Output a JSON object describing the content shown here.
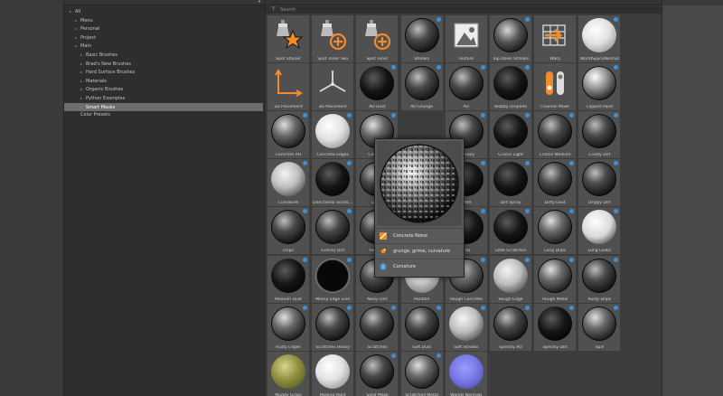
{
  "tree": {
    "items": [
      {
        "label": "All",
        "indent": 0,
        "expandable": true,
        "selected": false
      },
      {
        "label": "Menu",
        "indent": 1,
        "expandable": true,
        "selected": false
      },
      {
        "label": "Personal",
        "indent": 1,
        "expandable": true,
        "selected": false
      },
      {
        "label": "Project",
        "indent": 1,
        "expandable": true,
        "selected": false
      },
      {
        "label": "Main",
        "indent": 1,
        "expandable": true,
        "selected": false
      },
      {
        "label": "Basic Brushes",
        "indent": 2,
        "expandable": true,
        "selected": false
      },
      {
        "label": "Brad's New Brushes",
        "indent": 2,
        "expandable": true,
        "selected": false
      },
      {
        "label": "Hard Surface Brushes",
        "indent": 2,
        "expandable": true,
        "selected": false
      },
      {
        "label": "Materials",
        "indent": 2,
        "expandable": true,
        "selected": false
      },
      {
        "label": "Organic Brushes",
        "indent": 2,
        "expandable": true,
        "selected": false
      },
      {
        "label": "Python Examples",
        "indent": 2,
        "expandable": true,
        "selected": false
      },
      {
        "label": "Smart Masks",
        "indent": 2,
        "expandable": true,
        "selected": true
      },
      {
        "label": "Color Presets",
        "indent": 1,
        "expandable": false,
        "selected": false
      }
    ]
  },
  "search": {
    "placeholder": "Search"
  },
  "colors": {
    "accent": "#f28c28",
    "badge": "#3d8fd8",
    "selection": "#6d6d6d"
  },
  "tiles": [
    {
      "label": "Spot Stainer",
      "kind": "icon-drop-star",
      "badge": false
    },
    {
      "label": "Spot Toner Two",
      "kind": "icon-drop-plus",
      "badge": false
    },
    {
      "label": "Spot Toner",
      "kind": "icon-drop-plus",
      "badge": false
    },
    {
      "label": "Streaks",
      "kind": "sphere-dark",
      "badge": true
    },
    {
      "label": "Texture",
      "kind": "icon-image",
      "badge": false
    },
    {
      "label": "Top Down Streaks",
      "kind": "sphere-streak",
      "badge": true
    },
    {
      "label": "Warp",
      "kind": "icon-warp",
      "badge": false
    },
    {
      "label": "WorldSpaceNormal",
      "kind": "sphere-white",
      "badge": true
    },
    {
      "label": "2D Placement",
      "kind": "icon-axes",
      "badge": false
    },
    {
      "label": "3D Placement",
      "kind": "icon-axes3d",
      "badge": false
    },
    {
      "label": "AO Dust",
      "kind": "sphere-black",
      "badge": true
    },
    {
      "label": "AO Grunge",
      "kind": "sphere-dark",
      "badge": true
    },
    {
      "label": "AO",
      "kind": "sphere-dark",
      "badge": true
    },
    {
      "label": "Blobby Droplets",
      "kind": "sphere-black",
      "badge": true
    },
    {
      "label": "Channel Mixer",
      "kind": "icon-mixer",
      "badge": false
    },
    {
      "label": "Clipped Paint",
      "kind": "sphere-speckle",
      "badge": true
    },
    {
      "label": "Concrete AO",
      "kind": "sphere-grunge",
      "badge": true
    },
    {
      "label": "Concrete Edges",
      "kind": "sphere-white",
      "badge": true
    },
    {
      "label": "Concre...",
      "kind": "sphere-grunge",
      "badge": true
    },
    {
      "label": "",
      "kind": "hidden",
      "badge": false
    },
    {
      "label": "...Heavy",
      "kind": "sphere-dark",
      "badge": true
    },
    {
      "label": "Cracks Light",
      "kind": "sphere-black",
      "badge": true
    },
    {
      "label": "Cracks Medium",
      "kind": "sphere-dark",
      "badge": true
    },
    {
      "label": "Crusty Dirt",
      "kind": "sphere-dark",
      "badge": true
    },
    {
      "label": "Curvature",
      "kind": "sphere-light",
      "badge": true
    },
    {
      "label": "Directional Scratc...",
      "kind": "sphere-black",
      "badge": true
    },
    {
      "label": "Dirt...",
      "kind": "sphere-dark",
      "badge": true
    },
    {
      "label": "",
      "kind": "hidden",
      "badge": false
    },
    {
      "label": "...lter",
      "kind": "sphere-black",
      "badge": true
    },
    {
      "label": "Dirt Spray",
      "kind": "sphere-black",
      "badge": true
    },
    {
      "label": "Dirty Dust",
      "kind": "sphere-dark",
      "badge": true
    },
    {
      "label": "Drippy Dirt",
      "kind": "sphere-dark",
      "badge": true
    },
    {
      "label": "Drips",
      "kind": "sphere-dark",
      "badge": true
    },
    {
      "label": "Grimey Dirt",
      "kind": "sphere-dark",
      "badge": true
    },
    {
      "label": "Heavy...",
      "kind": "sphere-dark",
      "badge": true
    },
    {
      "label": "",
      "kind": "hidden",
      "badge": false
    },
    {
      "label": "...ks",
      "kind": "sphere-black",
      "badge": true
    },
    {
      "label": "Little Scratches",
      "kind": "sphere-black",
      "badge": true
    },
    {
      "label": "Long Drips",
      "kind": "sphere-grunge",
      "badge": true
    },
    {
      "label": "Long Leaks",
      "kind": "sphere-white-streak",
      "badge": true
    },
    {
      "label": "Medium Dust",
      "kind": "sphere-black",
      "badge": true
    },
    {
      "label": "Messy Edge Line",
      "kind": "sphere-black-rim",
      "badge": true
    },
    {
      "label": "Noisy Dirt",
      "kind": "sphere-dark",
      "badge": true
    },
    {
      "label": "Position",
      "kind": "sphere-gradient",
      "badge": true
    },
    {
      "label": "Rough Concrete",
      "kind": "sphere-grunge",
      "badge": true
    },
    {
      "label": "Rough Edge",
      "kind": "sphere-light",
      "badge": true
    },
    {
      "label": "Rough Metal",
      "kind": "sphere-grunge",
      "badge": true
    },
    {
      "label": "Rusty Drips",
      "kind": "sphere-dark",
      "badge": true
    },
    {
      "label": "Rusty Edges",
      "kind": "sphere-grunge",
      "badge": true
    },
    {
      "label": "Scratches Heavy",
      "kind": "sphere-dark",
      "badge": true
    },
    {
      "label": "Scratches",
      "kind": "sphere-dark",
      "badge": true
    },
    {
      "label": "Soft Dust",
      "kind": "sphere-dark",
      "badge": true
    },
    {
      "label": "Soft Streaks",
      "kind": "sphere-light",
      "badge": true
    },
    {
      "label": "Speckly AO",
      "kind": "sphere-dark",
      "badge": true
    },
    {
      "label": "Speckly Dirt",
      "kind": "sphere-black",
      "badge": true
    },
    {
      "label": "Spill",
      "kind": "sphere-grunge",
      "badge": true
    },
    {
      "label": "Muddy Grass",
      "kind": "sphere-grass",
      "badge": false
    },
    {
      "label": "Peeling Paint",
      "kind": "sphere-white",
      "badge": false
    },
    {
      "label": "Sand Mask",
      "kind": "sphere-dark",
      "badge": true
    },
    {
      "label": "Scratched Metal",
      "kind": "sphere-grunge",
      "badge": true
    },
    {
      "label": "Worlds Normals",
      "kind": "sphere-normal",
      "badge": false
    }
  ],
  "popup": {
    "name": "Concrete Noise",
    "tags": "grunge, grime, curvature",
    "type": "Curvature"
  }
}
